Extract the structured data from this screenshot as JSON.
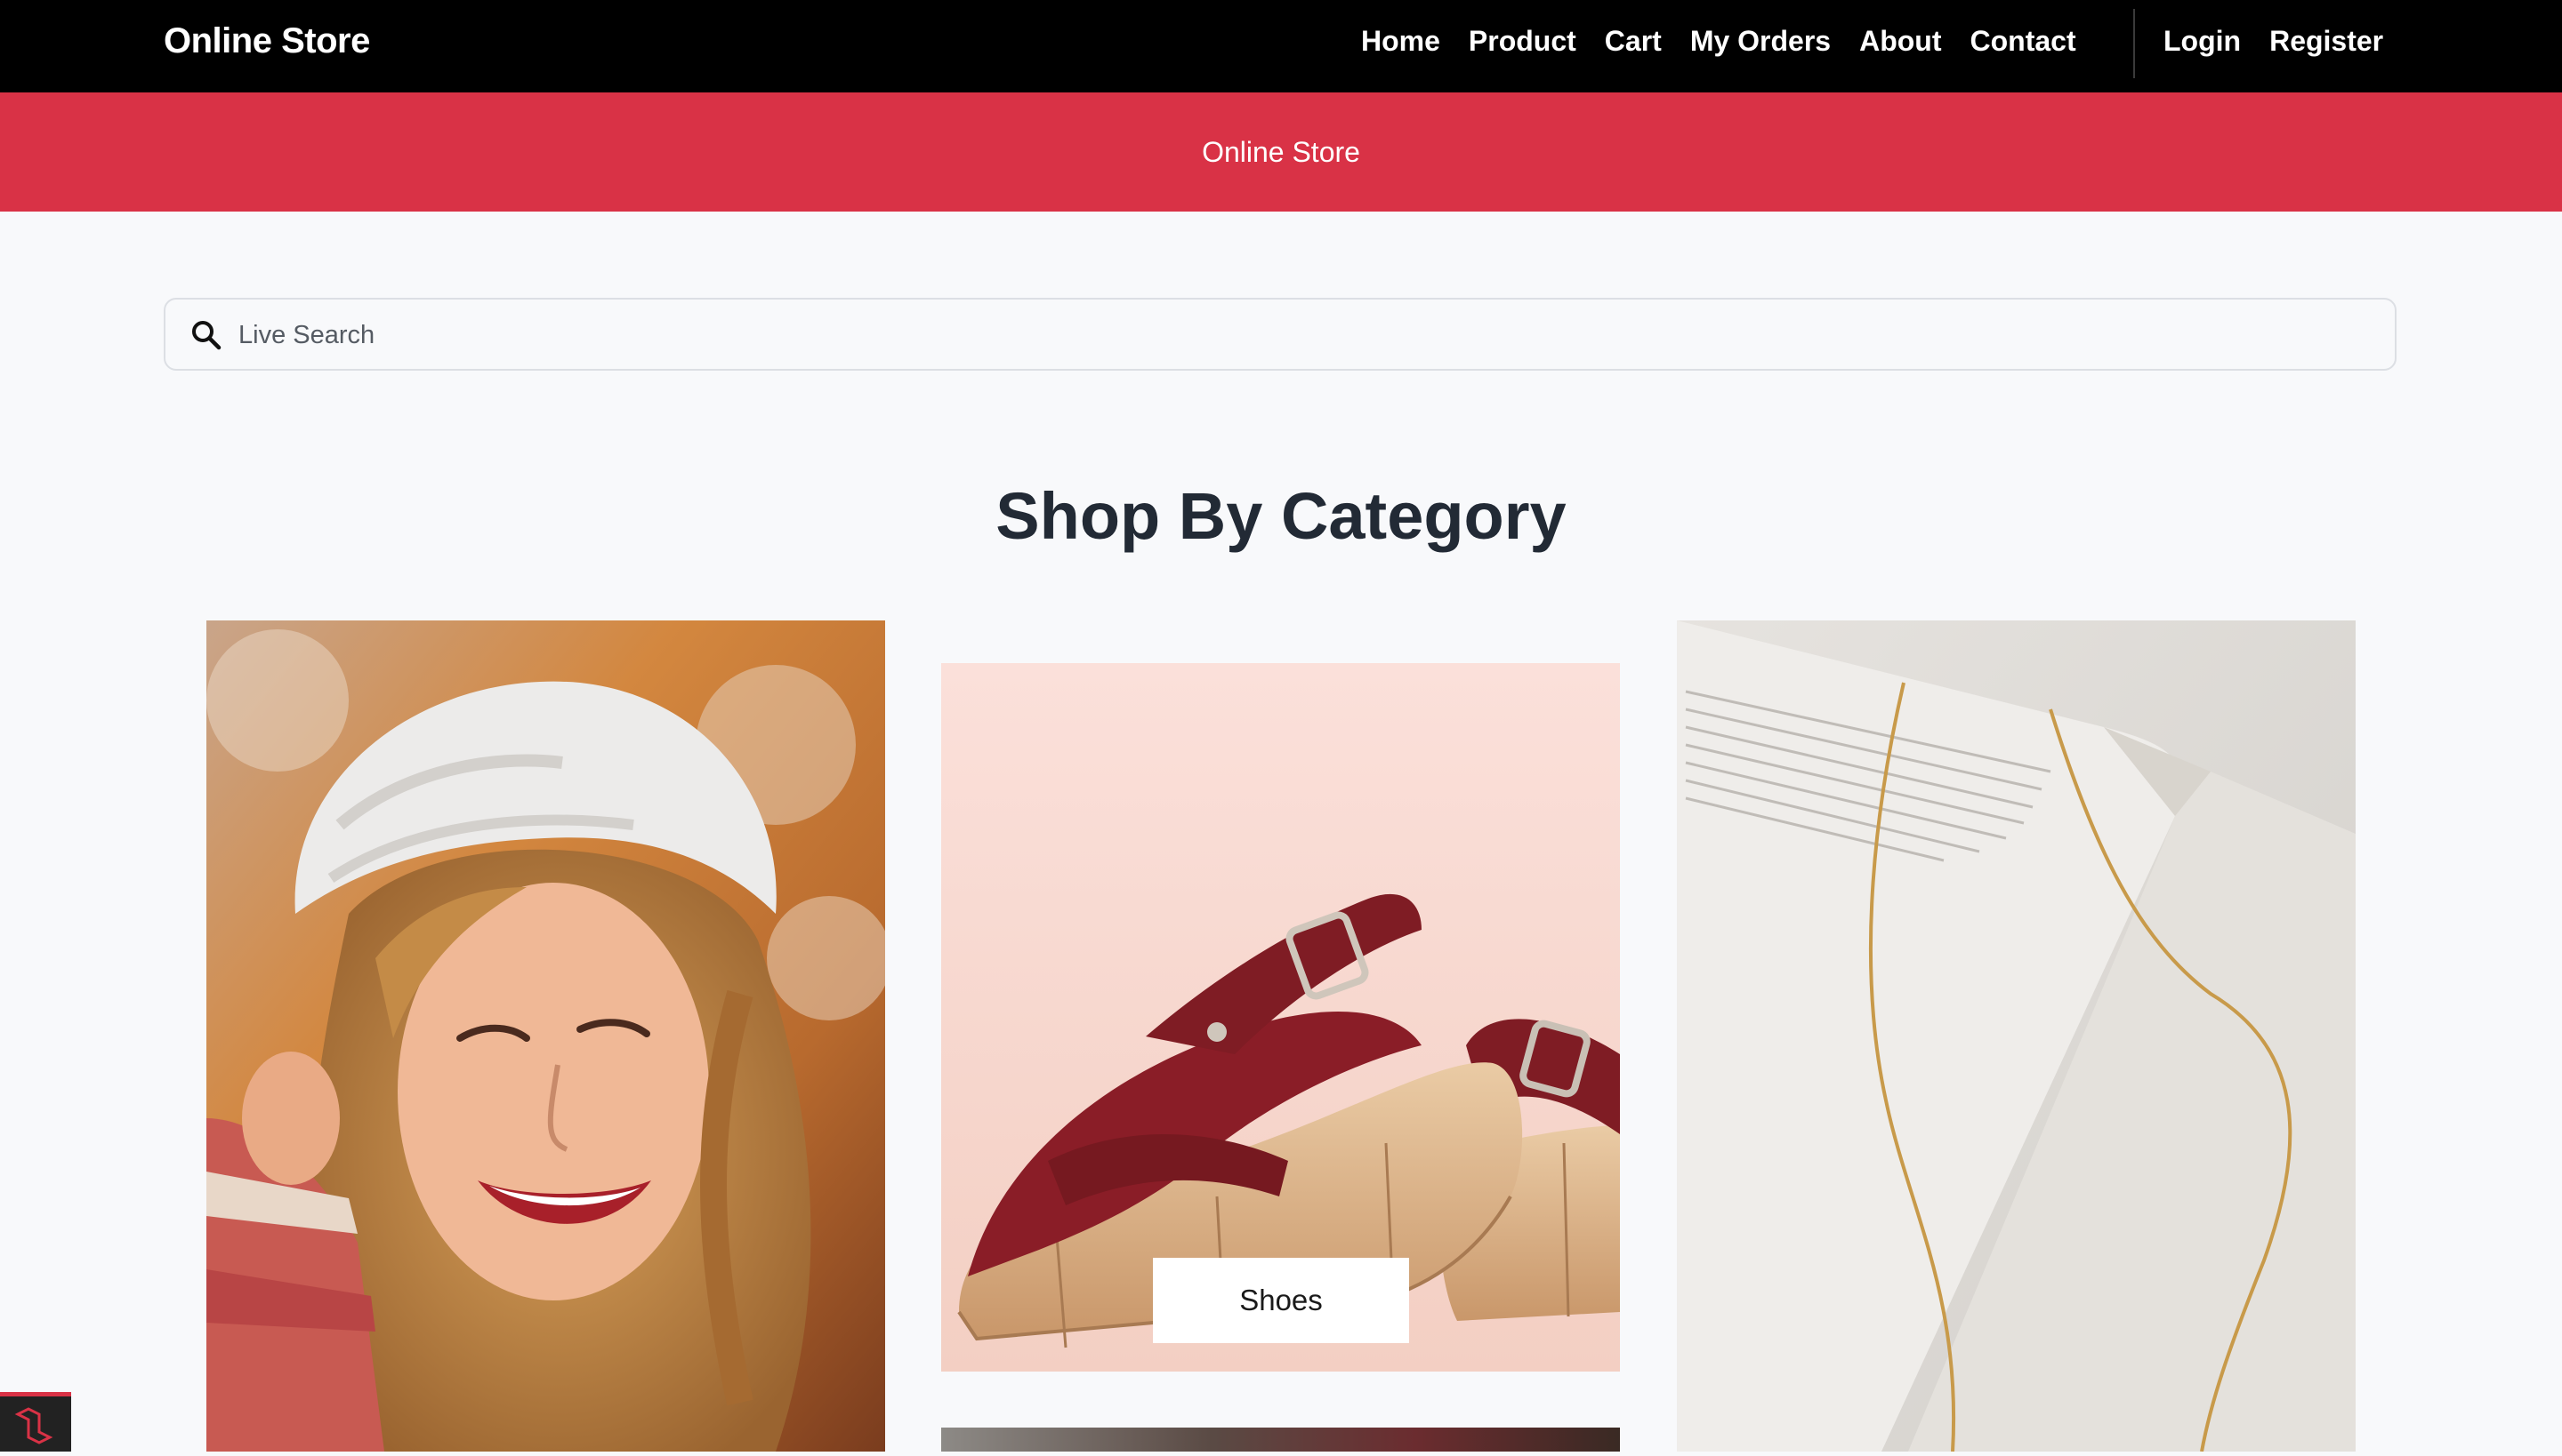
{
  "navbar": {
    "brand": "Online Store",
    "links": [
      "Home",
      "Product",
      "Cart",
      "My Orders",
      "About",
      "Contact"
    ],
    "auth": [
      "Login",
      "Register"
    ]
  },
  "banner": {
    "title": "Online Store"
  },
  "search": {
    "placeholder": "Live Search",
    "value": ""
  },
  "section": {
    "title": "Shop By Category"
  },
  "categories": [
    {
      "label": "",
      "image": "woman-in-knit-hat-photo"
    },
    {
      "label": "Shoes",
      "image": "red-platform-sandals-photo"
    },
    {
      "label": "",
      "image": "necklace-on-book-photo"
    }
  ],
  "colors": {
    "navbar": "#000000",
    "banner": "#d93246",
    "background": "#f8f9fb",
    "heading": "#222a35"
  }
}
